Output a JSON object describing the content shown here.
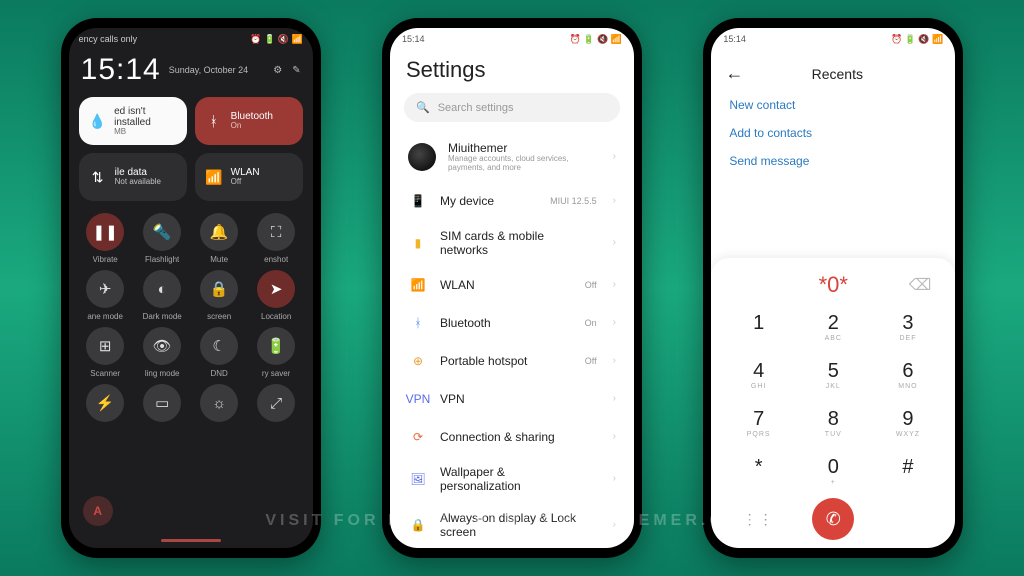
{
  "watermark": "VISIT FOR MORE THEMES   MIUITHEMER.COM",
  "qs": {
    "status_left": "ency calls only",
    "status_right": "⏰ 🔋 🔇 📶",
    "time": "15:14",
    "date": "Sunday, October 24",
    "big_tiles": [
      {
        "icon": "💧",
        "label": "ed isn't installed",
        "sub": "MB",
        "style": "white"
      },
      {
        "icon": "ᚼ",
        "label": "Bluetooth",
        "sub": "On",
        "style": "red"
      },
      {
        "icon": "⇅",
        "label": "ile data",
        "sub": "Not available",
        "style": ""
      },
      {
        "icon": "📶",
        "label": "WLAN",
        "sub": "Off",
        "style": ""
      }
    ],
    "sm_tiles": [
      {
        "icon": "❚❚",
        "label": "Vibrate",
        "active": true
      },
      {
        "icon": "🔦",
        "label": "Flashlight"
      },
      {
        "icon": "🔔",
        "label": "Mute"
      },
      {
        "icon": "⛶",
        "label": "enshot"
      },
      {
        "icon": "✈",
        "label": "ane mode"
      },
      {
        "icon": "◐",
        "label": "Dark mode"
      },
      {
        "icon": "🔒",
        "label": "screen"
      },
      {
        "icon": "➤",
        "label": "Location",
        "active": true
      },
      {
        "icon": "⊞",
        "label": "Scanner"
      },
      {
        "icon": "👁",
        "label": "ling mode"
      },
      {
        "icon": "☾",
        "label": "DND"
      },
      {
        "icon": "🔋",
        "label": "ry saver"
      },
      {
        "icon": "⚡",
        "label": ""
      },
      {
        "icon": "▭",
        "label": ""
      },
      {
        "icon": "☼",
        "label": ""
      },
      {
        "icon": "⤢",
        "label": ""
      }
    ],
    "a_label": "A"
  },
  "settings": {
    "status_left": "15:14",
    "status_right": "⏰ 🔋 🔇 📶",
    "title": "Settings",
    "search_placeholder": "Search settings",
    "account_name": "Miuithemer",
    "account_sub": "Manage accounts, cloud services, payments, and more",
    "rows": [
      {
        "icon": "📱",
        "color": "#4aa3e0",
        "label": "My device",
        "value": "MIUI 12.5.5"
      },
      {
        "icon": "▮",
        "color": "#f0b429",
        "label": "SIM cards & mobile networks",
        "value": ""
      },
      {
        "icon": "📶",
        "color": "#3b96e8",
        "label": "WLAN",
        "value": "Off"
      },
      {
        "icon": "ᚼ",
        "color": "#4a8ce8",
        "label": "Bluetooth",
        "value": "On"
      },
      {
        "icon": "⊕",
        "color": "#e8a23b",
        "label": "Portable hotspot",
        "value": "Off"
      },
      {
        "icon": "VPN",
        "color": "#5a6be8",
        "label": "VPN",
        "value": ""
      },
      {
        "icon": "⟳",
        "color": "#e86a3b",
        "label": "Connection & sharing",
        "value": ""
      },
      {
        "icon": "🖼",
        "color": "#5a6be8",
        "label": "Wallpaper & personalization",
        "value": ""
      },
      {
        "icon": "🔒",
        "color": "#e86a3b",
        "label": "Always-on display & Lock screen",
        "value": ""
      }
    ]
  },
  "dialer": {
    "status_left": "15:14",
    "status_right": "⏰ 🔋 🔇 📶",
    "title": "Recents",
    "links": [
      "New contact",
      "Add to contacts",
      "Send message"
    ],
    "entered": "*0*",
    "keys": [
      {
        "d": "1",
        "l": ""
      },
      {
        "d": "2",
        "l": "ABC"
      },
      {
        "d": "3",
        "l": "DEF"
      },
      {
        "d": "4",
        "l": "GHI"
      },
      {
        "d": "5",
        "l": "JKL"
      },
      {
        "d": "6",
        "l": "MNO"
      },
      {
        "d": "7",
        "l": "PQRS"
      },
      {
        "d": "8",
        "l": "TUV"
      },
      {
        "d": "9",
        "l": "WXYZ"
      },
      {
        "d": "*",
        "l": ""
      },
      {
        "d": "0",
        "l": "+"
      },
      {
        "d": "#",
        "l": ""
      }
    ]
  }
}
